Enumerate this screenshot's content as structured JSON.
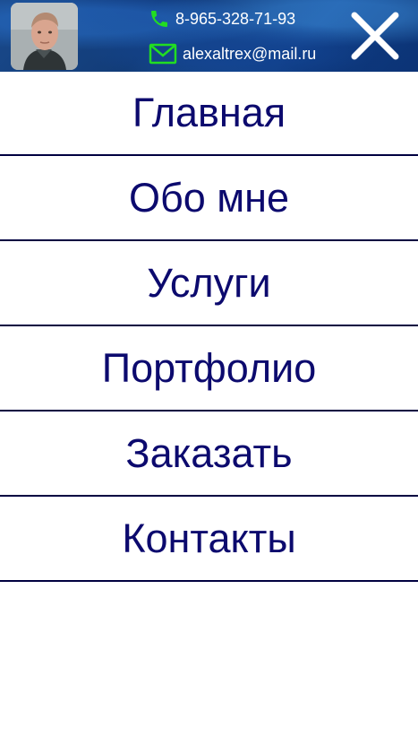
{
  "header": {
    "phone": "8-965-328-71-93",
    "email": "alexaltrex@mail.ru",
    "icons": {
      "avatar": "person-photo",
      "phone": "phone-icon",
      "email": "envelope-icon",
      "close": "close-icon"
    },
    "colors": {
      "icon_accent": "#22dd22",
      "text": "#ffffff"
    }
  },
  "menu": {
    "items": [
      {
        "label": "Главная"
      },
      {
        "label": "Обо мне"
      },
      {
        "label": "Услуги"
      },
      {
        "label": "Портфолио"
      },
      {
        "label": "Заказать"
      },
      {
        "label": "Контакты"
      }
    ],
    "colors": {
      "text": "#0c0a6e",
      "divider": "#000040"
    }
  }
}
